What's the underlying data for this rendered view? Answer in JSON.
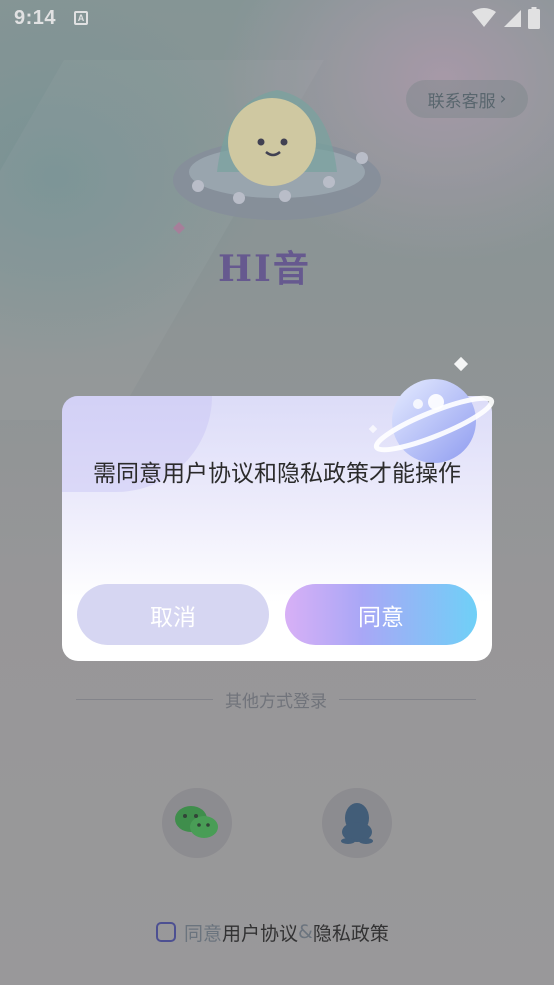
{
  "status_bar": {
    "time": "9:14",
    "notif_letter": "A"
  },
  "header": {
    "service_label": "联系客服",
    "service_chevron": "›"
  },
  "brand": {
    "logo_text": "HI音"
  },
  "other_login": {
    "label": "其他方式登录"
  },
  "agreement": {
    "prefix": "同意",
    "user_agreement": "用户协议",
    "amp": "&",
    "privacy_policy": "隐私政策"
  },
  "dialog": {
    "message": "需同意用户协议和隐私政策才能操作",
    "cancel_label": "取消",
    "confirm_label": "同意"
  },
  "colors": {
    "accent_gradient_start": "#d8b0f6",
    "accent_gradient_end": "#6fd0f7",
    "cancel_bg": "#d6d6f2"
  },
  "icons": [
    "wifi-icon",
    "signal-icon",
    "battery-icon",
    "chevron-right-icon",
    "wechat-icon",
    "qq-icon",
    "planet-icon"
  ]
}
